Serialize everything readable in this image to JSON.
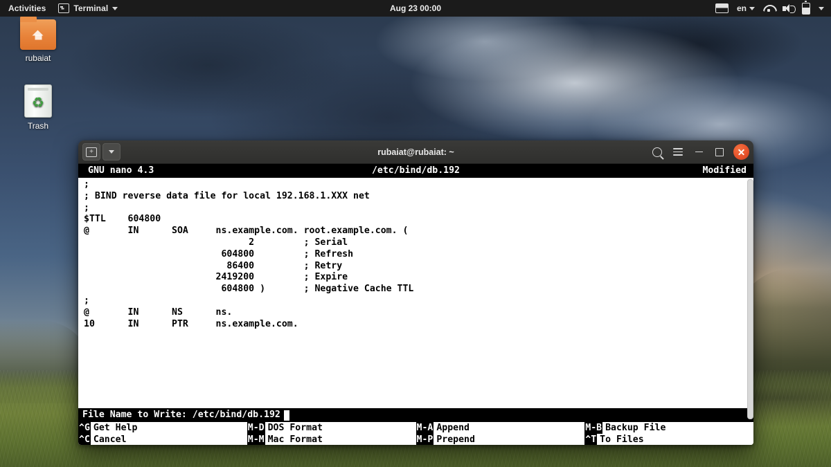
{
  "topbar": {
    "activities": "Activities",
    "app_name": "Terminal",
    "app_icon": "terminal-icon",
    "clock": "Aug 23  00:00",
    "keyboard_layout": "en",
    "icons": [
      "display-icon",
      "wifi-icon",
      "volume-icon",
      "battery-icon",
      "chevron-down-icon"
    ]
  },
  "desktop": {
    "icons": [
      {
        "label": "rubaiat",
        "type": "home-folder"
      },
      {
        "label": "Trash",
        "type": "trash"
      }
    ]
  },
  "terminal": {
    "title": "rubaiat@rubaiat: ~",
    "titlebar_buttons": {
      "new_tab": "new-tab-button",
      "dropdown": "tab-dropdown-button",
      "search": "search-button",
      "menu": "hamburger-menu-button",
      "minimize": "minimize-button",
      "maximize": "maximize-button",
      "close": "close-button"
    }
  },
  "nano": {
    "header": {
      "version": "GNU nano 4.3",
      "file": "/etc/bind/db.192",
      "state": "Modified"
    },
    "content_lines": [
      ";",
      "; BIND reverse data file for local 192.168.1.XXX net",
      ";",
      "$TTL    604800",
      "@       IN      SOA     ns.example.com. root.example.com. (",
      "                              2         ; Serial",
      "                         604800         ; Refresh",
      "                          86400         ; Retry",
      "                        2419200         ; Expire",
      "                         604800 )       ; Negative Cache TTL",
      ";",
      "@       IN      NS      ns.",
      "10      IN      PTR     ns.example.com."
    ],
    "prompt": {
      "label": "File Name to Write: ",
      "value": "/etc/bind/db.192"
    },
    "shortcuts": [
      {
        "combo": "^G",
        "label": "Get Help"
      },
      {
        "combo": "M-D",
        "label": "DOS Format"
      },
      {
        "combo": "M-A",
        "label": "Append"
      },
      {
        "combo": "M-B",
        "label": "Backup File"
      },
      {
        "combo": "^C",
        "label": "Cancel"
      },
      {
        "combo": "M-M",
        "label": "Mac Format"
      },
      {
        "combo": "M-P",
        "label": "Prepend"
      },
      {
        "combo": "^T",
        "label": "To Files"
      }
    ]
  },
  "colors": {
    "accent_orange": "#e5502a",
    "topbar_bg": "#1b1b1b",
    "titlebar_bg": "#2f2f2d",
    "nano_bar_bg": "#000000",
    "editor_bg": "#ffffff"
  }
}
